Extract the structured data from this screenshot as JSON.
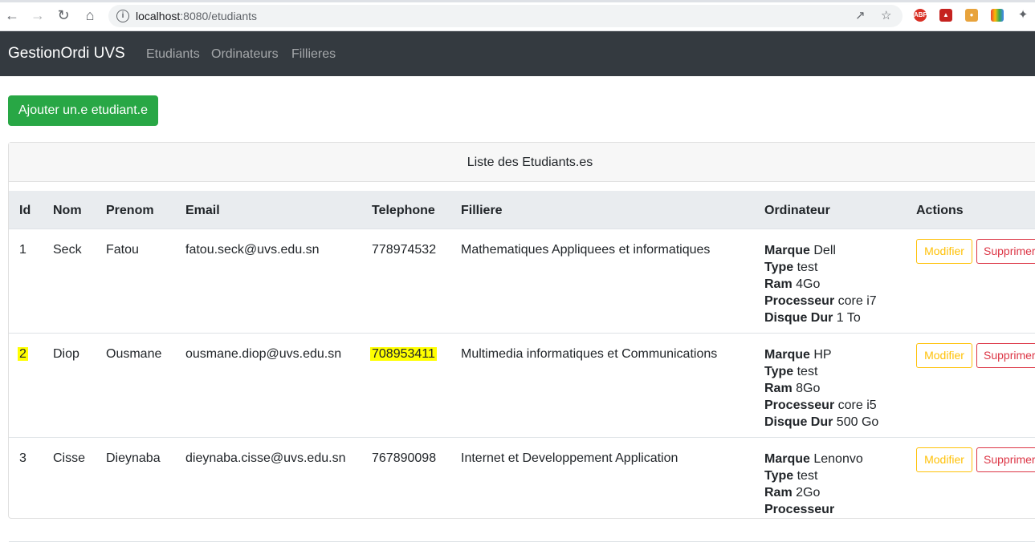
{
  "browser": {
    "url_host": "localhost",
    "url_rest": ":8080/etudiants"
  },
  "navbar": {
    "brand": "GestionOrdi UVS",
    "links": [
      "Etudiants",
      "Ordinateurs",
      "Fillieres"
    ]
  },
  "add_button": "Ajouter un.e etudiant.e",
  "card": {
    "title": "Liste des Etudiants.es"
  },
  "table": {
    "headers": [
      "Id",
      "Nom",
      "Prenom",
      "Email",
      "Telephone",
      "Filliere",
      "Ordinateur",
      "Actions"
    ],
    "rows": [
      {
        "id": "1",
        "nom": "Seck",
        "prenom": "Fatou",
        "email": "fatou.seck@uvs.edu.sn",
        "telephone": "778974532",
        "filliere": "Mathematiques Appliquees et informatiques",
        "ordinateur": {
          "marque": "Dell",
          "type": "test",
          "ram": "4Go",
          "processeur": "core i7",
          "disque": "1 To"
        },
        "modifier": "Modifier",
        "supprimer": "Supprimer"
      },
      {
        "id": "2",
        "nom": "Diop",
        "prenom": "Ousmane",
        "email": "ousmane.diop@uvs.edu.sn",
        "telephone": "708953411",
        "filliere": "Multimedia informatiques et Communications",
        "ordinateur": {
          "marque": "HP",
          "type": "test",
          "ram": "8Go",
          "processeur": "core i5",
          "disque": "500 Go"
        },
        "modifier": "Modifier",
        "supprimer": "Supprimer"
      },
      {
        "id": "3",
        "nom": "Cisse",
        "prenom": "Dieynaba",
        "email": "dieynaba.cisse@uvs.edu.sn",
        "telephone": "767890098",
        "filliere": "Internet et Developpement Application",
        "ordinateur": {
          "marque": "Lenonvo",
          "type": "test",
          "ram": "2Go",
          "processeur": "",
          "disque": ""
        },
        "modifier": "Modifier",
        "supprimer": "Supprimer"
      }
    ],
    "ord_labels": {
      "marque": "Marque",
      "type": "Type",
      "ram": "Ram",
      "processeur": "Processeur",
      "disque": "Disque Dur"
    }
  },
  "colors": {
    "navbar": "#343a40",
    "success": "#28a745",
    "warning": "#ffc107",
    "danger": "#dc3545",
    "highlight": "#ffff00"
  }
}
